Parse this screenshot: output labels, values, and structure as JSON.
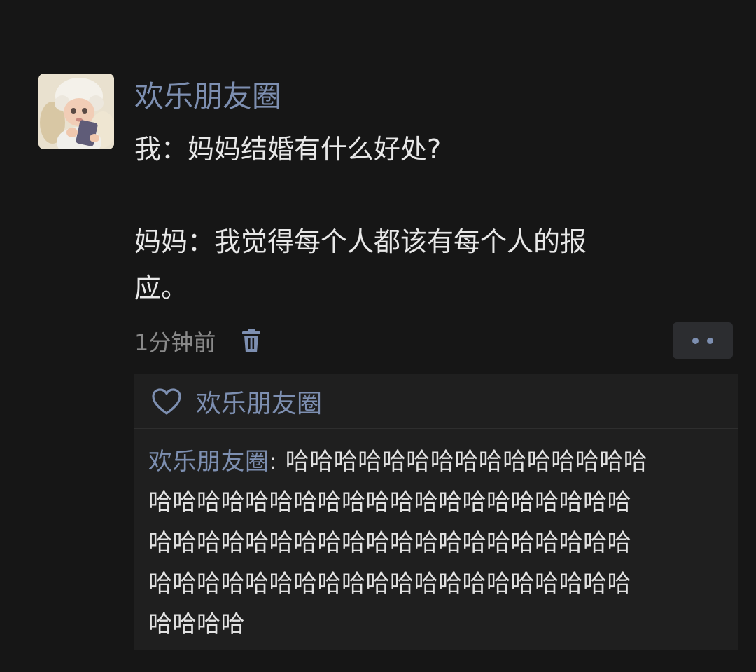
{
  "post": {
    "author": "欢乐朋友圈",
    "content_lines": [
      "我：妈妈结婚有什么好处?",
      "妈妈：我觉得每个人都该有每个人的报",
      "应。"
    ],
    "time": "1分钟前"
  },
  "icons": {
    "delete": "trash-icon",
    "more": "more-dots-icon",
    "like": "heart-icon"
  },
  "likes": {
    "names": "欢乐朋友圈"
  },
  "comment": {
    "author": "欢乐朋友圈",
    "separator": ": ",
    "lines": [
      "哈哈哈哈哈哈哈哈哈哈哈哈哈哈哈",
      "哈哈哈哈哈哈哈哈哈哈哈哈哈哈哈哈哈哈哈哈",
      "哈哈哈哈哈哈哈哈哈哈哈哈哈哈哈哈哈哈哈哈",
      "哈哈哈哈哈哈哈哈哈哈哈哈哈哈哈哈哈哈哈哈",
      "哈哈哈哈"
    ]
  },
  "colors": {
    "background": "#161616",
    "name_link": "#7d8fb1",
    "text": "#e8e8e8",
    "muted": "#8a8a8a",
    "panel": "#1f1f1f"
  }
}
